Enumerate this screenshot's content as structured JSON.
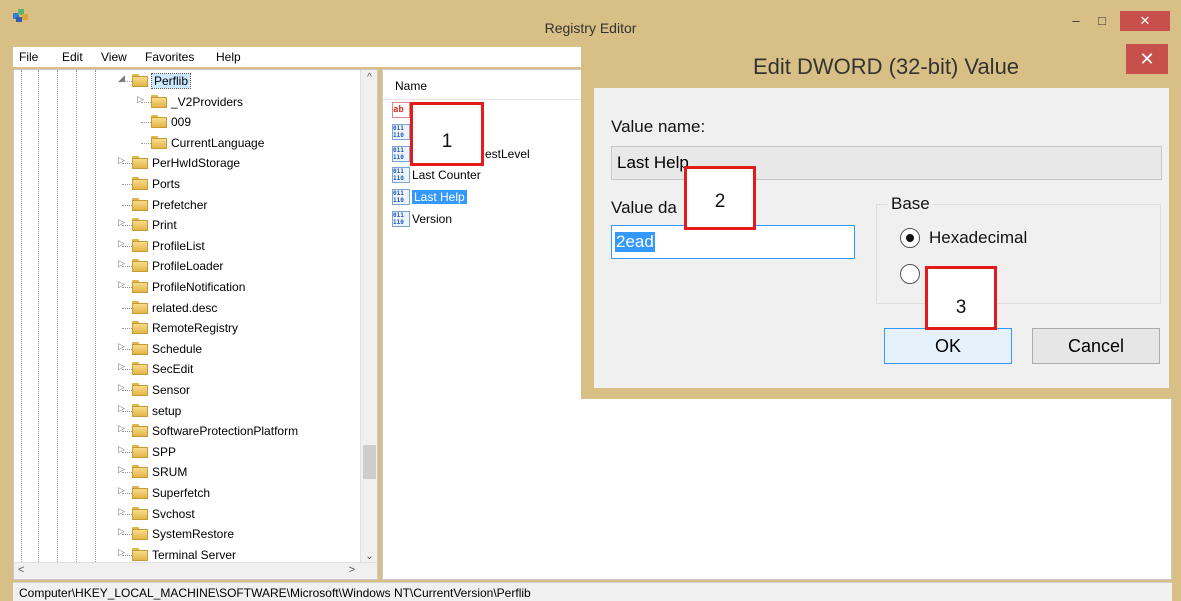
{
  "window": {
    "title": "Registry Editor",
    "min_glyph": "–",
    "max_glyph": "□",
    "close_glyph": "✕"
  },
  "menu": [
    "File",
    "Edit",
    "View",
    "Favorites",
    "Help"
  ],
  "tree": {
    "items": [
      {
        "label": "Perflib",
        "expander": "◢",
        "selected": true
      },
      {
        "label": "_V2Providers",
        "expander": "▷",
        "selected": false
      },
      {
        "label": "009",
        "expander": "",
        "selected": false
      },
      {
        "label": "CurrentLanguage",
        "expander": "",
        "selected": false
      },
      {
        "label": "PerHwIdStorage",
        "expander": "▷",
        "selected": false
      },
      {
        "label": "Ports",
        "expander": "",
        "selected": false
      },
      {
        "label": "Prefetcher",
        "expander": "",
        "selected": false
      },
      {
        "label": "Print",
        "expander": "▷",
        "selected": false
      },
      {
        "label": "ProfileList",
        "expander": "▷",
        "selected": false
      },
      {
        "label": "ProfileLoader",
        "expander": "▷",
        "selected": false
      },
      {
        "label": "ProfileNotification",
        "expander": "▷",
        "selected": false
      },
      {
        "label": "related.desc",
        "expander": "",
        "selected": false
      },
      {
        "label": "RemoteRegistry",
        "expander": "",
        "selected": false
      },
      {
        "label": "Schedule",
        "expander": "▷",
        "selected": false
      },
      {
        "label": "SecEdit",
        "expander": "▷",
        "selected": false
      },
      {
        "label": "Sensor",
        "expander": "▷",
        "selected": false
      },
      {
        "label": "setup",
        "expander": "▷",
        "selected": false
      },
      {
        "label": "SoftwareProtectionPlatform",
        "expander": "▷",
        "selected": false
      },
      {
        "label": "SPP",
        "expander": "▷",
        "selected": false
      },
      {
        "label": "SRUM",
        "expander": "▷",
        "selected": false
      },
      {
        "label": "Superfetch",
        "expander": "▷",
        "selected": false
      },
      {
        "label": "Svchost",
        "expander": "▷",
        "selected": false
      },
      {
        "label": "SystemRestore",
        "expander": "▷",
        "selected": false
      },
      {
        "label": "Terminal Server",
        "expander": "▷",
        "selected": false
      }
    ],
    "scroll_up": "^",
    "scroll_down": "⌄",
    "scroll_left": "<",
    "scroll_right": ">"
  },
  "values_list": {
    "column_name": "Name",
    "rows": [
      {
        "label": "",
        "icon": "ab",
        "selected": false
      },
      {
        "label": "",
        "icon": "dword",
        "selected": false
      },
      {
        "label": "estLevel",
        "icon": "dword",
        "selected": false
      },
      {
        "label": "Last Counter",
        "icon": "dword",
        "selected": false
      },
      {
        "label": "Last Help",
        "icon": "dword",
        "selected": true
      },
      {
        "label": "Version",
        "icon": "dword",
        "selected": false
      }
    ]
  },
  "status": {
    "path": "Computer\\HKEY_LOCAL_MACHINE\\SOFTWARE\\Microsoft\\Windows NT\\CurrentVersion\\Perflib"
  },
  "dialog": {
    "title": "Edit DWORD (32-bit) Value",
    "close_glyph": "✕",
    "value_name_label": "Value name:",
    "value_name": "Last Help",
    "value_data_label": "Value da",
    "value_data": "2ead",
    "base_label": "Base",
    "hex_label": "Hexadecimal",
    "hex_checked": true,
    "decimal_checked": false,
    "ok_label": "OK",
    "cancel_label": "Cancel"
  },
  "callouts": [
    "1",
    "2",
    "3"
  ],
  "colors": {
    "chrome": "#d8bf85",
    "close_red": "#c7504c",
    "selection_blue": "#3399ff",
    "callout_red": "#e31b1b"
  }
}
